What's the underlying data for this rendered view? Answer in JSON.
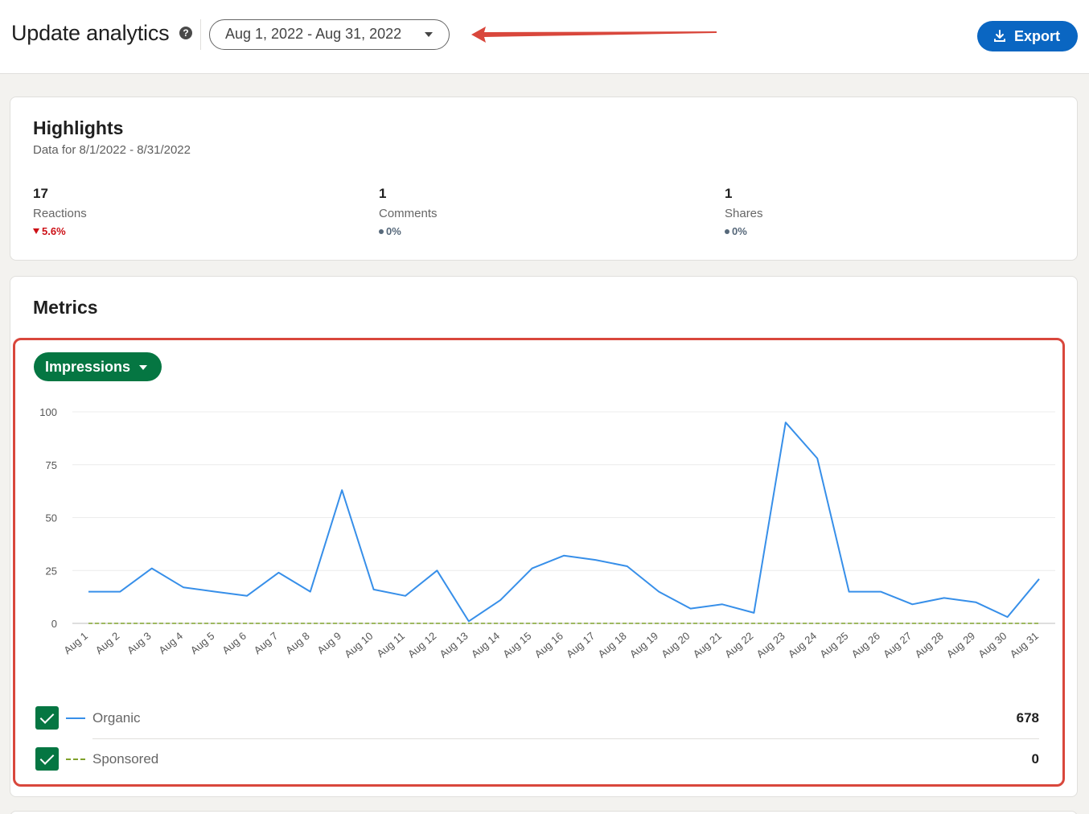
{
  "header": {
    "title": "Update analytics",
    "help_glyph": "?",
    "date_range": "Aug 1, 2022 - Aug 31, 2022",
    "export_label": "Export",
    "accent_color": "#0a66c2"
  },
  "highlights": {
    "title": "Highlights",
    "subtitle": "Data for 8/1/2022 - 8/31/2022",
    "stats": [
      {
        "value": "17",
        "label": "Reactions",
        "change": "5.6%",
        "trend": "down"
      },
      {
        "value": "1",
        "label": "Comments",
        "change": "0%",
        "trend": "flat"
      },
      {
        "value": "1",
        "label": "Shares",
        "change": "0%",
        "trend": "flat"
      }
    ]
  },
  "metrics": {
    "title": "Metrics",
    "metric_selector": "Impressions",
    "selector_color": "#057642",
    "legend": [
      {
        "name": "Organic",
        "total": "678",
        "color": "#378fe9",
        "style": "solid",
        "checked": true
      },
      {
        "name": "Sponsored",
        "total": "0",
        "color": "#7fa12b",
        "style": "dashed",
        "checked": true
      }
    ]
  },
  "chart_data": {
    "type": "line",
    "x": [
      "Aug 1",
      "Aug 2",
      "Aug 3",
      "Aug 4",
      "Aug 5",
      "Aug 6",
      "Aug 7",
      "Aug 8",
      "Aug 9",
      "Aug 10",
      "Aug 11",
      "Aug 12",
      "Aug 13",
      "Aug 14",
      "Aug 15",
      "Aug 16",
      "Aug 17",
      "Aug 18",
      "Aug 19",
      "Aug 20",
      "Aug 21",
      "Aug 22",
      "Aug 23",
      "Aug 24",
      "Aug 25",
      "Aug 26",
      "Aug 27",
      "Aug 28",
      "Aug 29",
      "Aug 30",
      "Aug 31"
    ],
    "series": [
      {
        "name": "Organic",
        "color": "#378fe9",
        "style": "solid",
        "values": [
          15,
          15,
          26,
          17,
          15,
          13,
          24,
          15,
          63,
          16,
          13,
          25,
          1,
          11,
          26,
          32,
          30,
          27,
          15,
          7,
          9,
          5,
          95,
          78,
          15,
          15,
          9,
          12,
          10,
          3,
          21
        ]
      },
      {
        "name": "Sponsored",
        "color": "#7fa12b",
        "style": "dashed",
        "values": [
          0,
          0,
          0,
          0,
          0,
          0,
          0,
          0,
          0,
          0,
          0,
          0,
          0,
          0,
          0,
          0,
          0,
          0,
          0,
          0,
          0,
          0,
          0,
          0,
          0,
          0,
          0,
          0,
          0,
          0,
          0
        ]
      }
    ],
    "yticks": [
      0,
      25,
      50,
      75,
      100
    ],
    "ylim": [
      0,
      100
    ],
    "grid": true
  }
}
